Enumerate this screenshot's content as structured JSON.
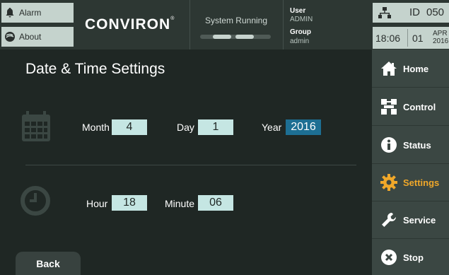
{
  "topbar": {
    "alarm_label": "Alarm",
    "about_label": "About",
    "logo_text": "CONVIRON",
    "logo_mark": "®",
    "status_text": "System Running",
    "user_label": "User",
    "user_value": "ADMIN",
    "group_label": "Group",
    "group_value": "admin",
    "id_label": "ID",
    "id_value": "050",
    "time": "18:06",
    "day": "01",
    "month": "APR",
    "year": "2016"
  },
  "page": {
    "title": "Date & Time Settings",
    "back_label": "Back"
  },
  "date": {
    "month_label": "Month",
    "month_value": "4",
    "day_label": "Day",
    "day_value": "1",
    "year_label": "Year",
    "year_value": "2016"
  },
  "time": {
    "hour_label": "Hour",
    "hour_value": "18",
    "minute_label": "Minute",
    "minute_value": "06"
  },
  "nav": {
    "items": [
      {
        "label": "Home",
        "icon": "home-icon"
      },
      {
        "label": "Control",
        "icon": "control-icon"
      },
      {
        "label": "Status",
        "icon": "info-icon"
      },
      {
        "label": "Settings",
        "icon": "gear-icon"
      },
      {
        "label": "Service",
        "icon": "wrench-icon"
      },
      {
        "label": "Stop",
        "icon": "stop-icon"
      }
    ]
  },
  "colors": {
    "background": "#1f2724",
    "accent_active": "#f0a82a",
    "field_bg": "#c5e6e3",
    "field_selected": "#1d6f93"
  }
}
